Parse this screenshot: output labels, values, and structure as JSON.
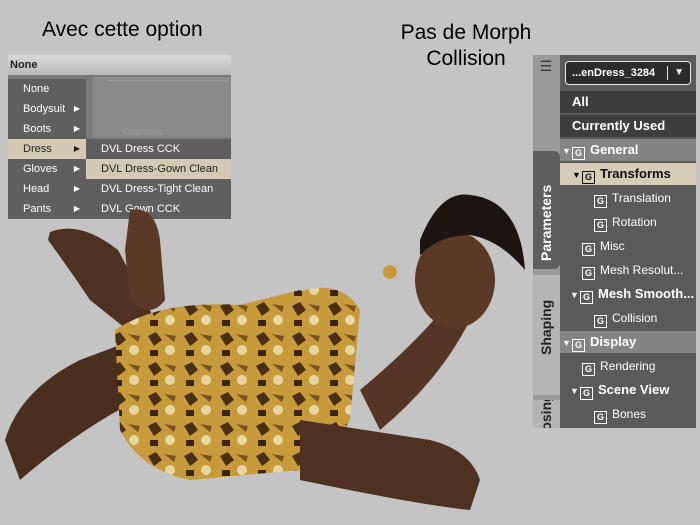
{
  "captions": {
    "left": "Avec cette option",
    "right_line1": "Pas de Morph",
    "right_line2": "Collision"
  },
  "menu": {
    "bar_label": "None",
    "bg_text": "Claimers",
    "items": [
      {
        "label": "None",
        "arrow": ""
      },
      {
        "label": "Bodysuit",
        "arrow": "▶"
      },
      {
        "label": "Boots",
        "arrow": "▶"
      },
      {
        "label": "Dress",
        "arrow": "▶"
      },
      {
        "label": "Gloves",
        "arrow": "▶"
      },
      {
        "label": "Head",
        "arrow": "▶"
      },
      {
        "label": "Pants",
        "arrow": "▶"
      }
    ],
    "highlighted_item": "Dress",
    "submenu": [
      {
        "label": "DVL Dress CCK"
      },
      {
        "label": "DVL Dress-Gown Clean"
      },
      {
        "label": "DVL Dress-Tight Clean"
      },
      {
        "label": "DVL Gown CCK"
      }
    ],
    "highlighted_sub": "DVL Dress-Gown Clean"
  },
  "side_tabs": {
    "menu_icon": "list-menu-icon",
    "parameters": "Parameters",
    "shaping": "Shaping",
    "posing": "Posing"
  },
  "panel": {
    "dropdown_value": "...enDress_3284",
    "dropdown_arrow": "▼",
    "rows": [
      {
        "text": "All",
        "kind": "dark"
      },
      {
        "text": "Currently Used",
        "kind": "dark"
      },
      {
        "text": "General",
        "kind": "sec"
      },
      {
        "text": "Transforms",
        "kind": "sel"
      },
      {
        "text": "Translation",
        "kind": "leaf"
      },
      {
        "text": "Rotation",
        "kind": "leaf"
      },
      {
        "text": "Misc",
        "kind": "leaf"
      },
      {
        "text": "Mesh Resolut...",
        "kind": "leaf"
      },
      {
        "text": "Mesh Smooth...",
        "kind": "group"
      },
      {
        "text": "Collision",
        "kind": "leaf"
      },
      {
        "text": "Display",
        "kind": "sec"
      },
      {
        "text": "Rendering",
        "kind": "leaf"
      },
      {
        "text": "Scene View",
        "kind": "group"
      },
      {
        "text": "Bones",
        "kind": "leaf"
      }
    ],
    "group_icon": "G",
    "expand_icon": "▼"
  },
  "colors": {
    "background": "#c4c4c4",
    "highlight": "#d7ccb8",
    "panel_bg": "#5a5a5a"
  }
}
